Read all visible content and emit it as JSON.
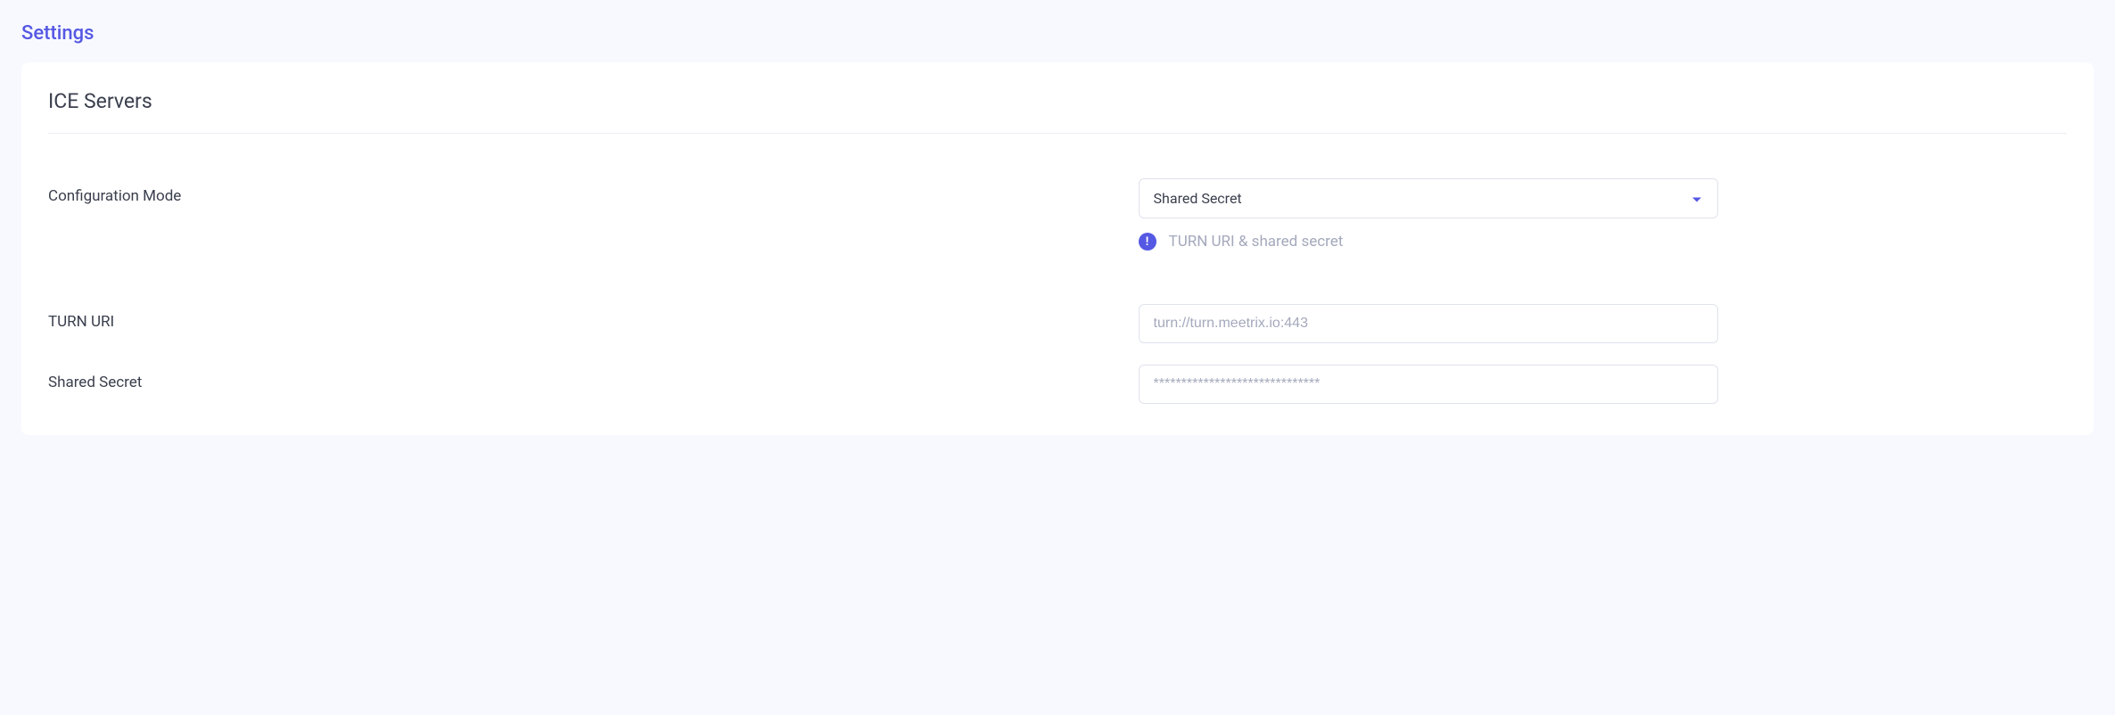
{
  "page": {
    "title": "Settings"
  },
  "section": {
    "title": "ICE Servers"
  },
  "config_mode": {
    "label": "Configuration Mode",
    "selected": "Shared Secret",
    "helper": "TURN URI & shared secret"
  },
  "turn_uri": {
    "label": "TURN URI",
    "placeholder": "turn://turn.meetrix.io:443"
  },
  "shared_secret": {
    "label": "Shared Secret",
    "placeholder": "******************************"
  }
}
